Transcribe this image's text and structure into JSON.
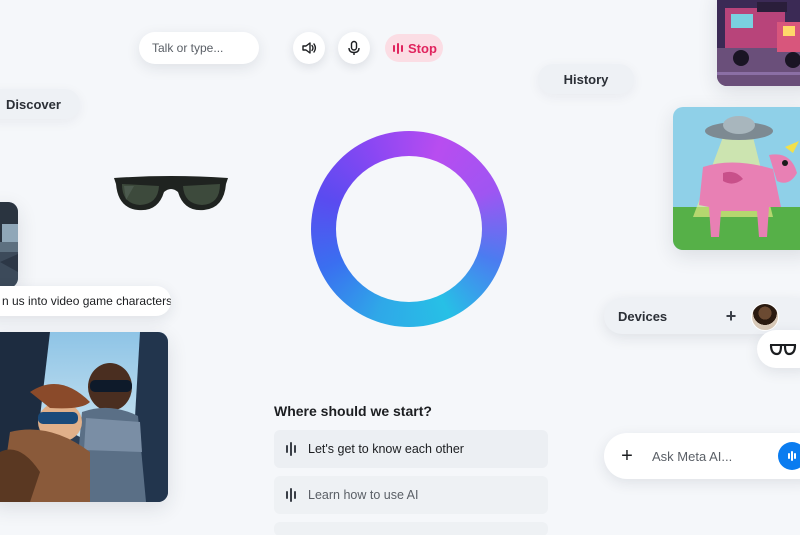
{
  "topbar": {
    "talk_placeholder": "Talk or type...",
    "stop_label": "Stop",
    "speaker_icon": "speaker-icon",
    "mic_icon": "microphone-icon"
  },
  "nav": {
    "history_label": "History",
    "discover_label": "Discover"
  },
  "cards": {
    "caption": "n us into video game characters"
  },
  "devices": {
    "label": "Devices",
    "add_symbol": "+",
    "glasses_icon": "glasses-icon"
  },
  "composer": {
    "add_symbol": "+",
    "placeholder": "Ask Meta AI..."
  },
  "start": {
    "title": "Where should we start?",
    "suggestions": [
      "Let's get to know each other",
      "Learn how to use AI"
    ]
  },
  "colors": {
    "accent_blue": "#0a7cf0",
    "stop_pink": "#e0245e",
    "stop_bg": "#fbdde4",
    "background": "#f5f7fa"
  }
}
